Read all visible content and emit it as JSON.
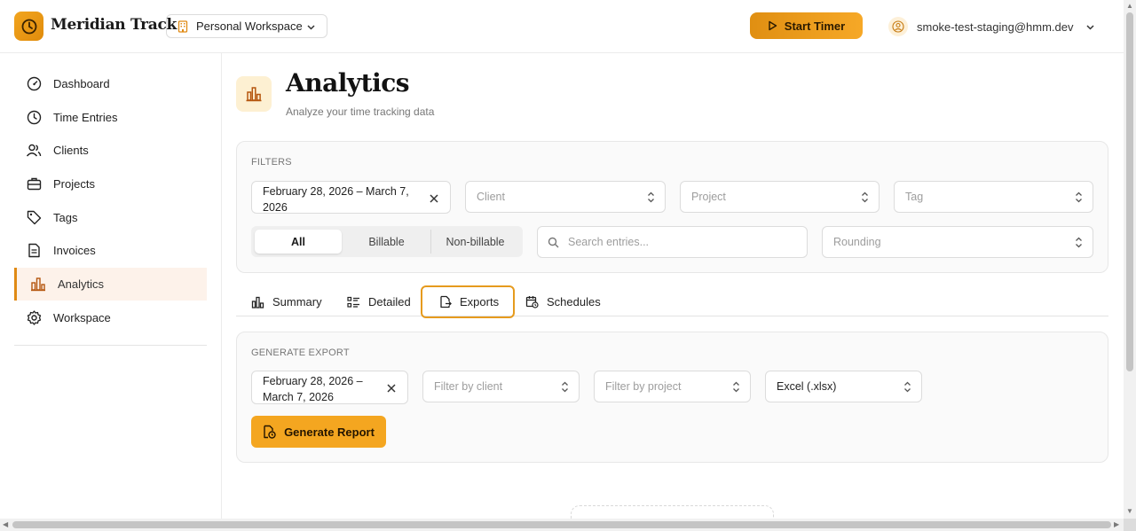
{
  "app": {
    "name": "Meridian Track"
  },
  "header": {
    "workspace": "Personal Workspace",
    "start_timer": "Start Timer",
    "user_email": "smoke-test-staging@hmm.dev"
  },
  "sidebar": {
    "items": [
      {
        "label": "Dashboard",
        "icon": "gauge-icon"
      },
      {
        "label": "Time Entries",
        "icon": "clock-icon"
      },
      {
        "label": "Clients",
        "icon": "users-icon"
      },
      {
        "label": "Projects",
        "icon": "briefcase-icon"
      },
      {
        "label": "Tags",
        "icon": "tag-icon"
      },
      {
        "label": "Invoices",
        "icon": "file-text-icon"
      },
      {
        "label": "Analytics",
        "icon": "bar-chart-icon",
        "active": true
      },
      {
        "label": "Workspace",
        "icon": "gear-icon"
      }
    ]
  },
  "page": {
    "title": "Analytics",
    "subtitle": "Analyze your time tracking data"
  },
  "filters": {
    "section_label": "FILTERS",
    "date_range_line1": "February 28, 2026 – March 7,",
    "date_range_line2": "2026",
    "client_placeholder": "Client",
    "project_placeholder": "Project",
    "tag_placeholder": "Tag",
    "billing": {
      "all": "All",
      "billable": "Billable",
      "non_billable": "Non-billable",
      "selected": "All"
    },
    "search_placeholder": "Search entries...",
    "rounding_placeholder": "Rounding"
  },
  "tabs": {
    "items": [
      {
        "label": "Summary"
      },
      {
        "label": "Detailed"
      },
      {
        "label": "Exports",
        "active": true
      },
      {
        "label": "Schedules"
      }
    ]
  },
  "export": {
    "section_label": "GENERATE EXPORT",
    "date_range_line1": "February 28, 2026 –",
    "date_range_line2": "March 7, 2026",
    "client_placeholder": "Filter by client",
    "project_placeholder": "Filter by project",
    "format": "Excel (.xlsx)",
    "generate_label": "Generate Report"
  },
  "colors": {
    "accent": "#f4a620",
    "accent_dark": "#e08a14",
    "active_bg": "#fdf2ea"
  }
}
